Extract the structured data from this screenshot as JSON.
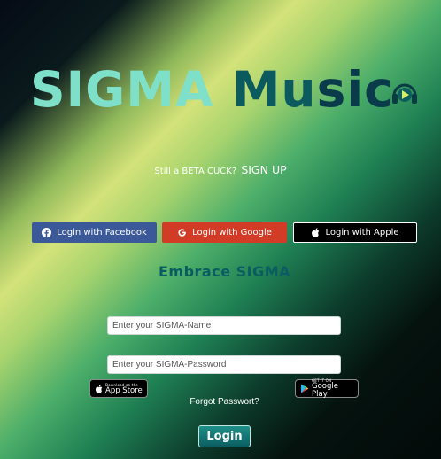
{
  "hero": {
    "word1": "SIGMA",
    "word2": "Mu",
    "word3": "sic"
  },
  "logo": {
    "icon": "headphones-play-icon"
  },
  "signup": {
    "prompt": "Still a BETA CUCK?",
    "link": "SIGN UP"
  },
  "social": {
    "facebook": {
      "label": "Login with Facebook",
      "icon": "facebook-icon",
      "color": "#3b5998"
    },
    "google": {
      "label": "Login with Google",
      "icon": "google-icon",
      "color": "#d23b26"
    },
    "apple": {
      "label": "Login with Apple",
      "icon": "apple-icon",
      "color": "#000000"
    }
  },
  "embrace": "Embrace SIGMA",
  "form": {
    "name_placeholder": "Enter your SIGMA-Name",
    "password_placeholder": "Enter your SIGMA-Password",
    "name_value": "",
    "password_value": ""
  },
  "stores": {
    "appstore": {
      "small": "Download on the",
      "big": "App Store",
      "icon": "apple-icon"
    },
    "googleplay": {
      "small": "GET IT ON",
      "big": "Google Play",
      "icon": "play-store-icon"
    }
  },
  "forgot": "Forgot Passwort?",
  "login": "Login",
  "colors": {
    "accent": "#0a5c62",
    "hero_light": "#7fe0c9",
    "hero_dark": "#0a3b4a"
  }
}
